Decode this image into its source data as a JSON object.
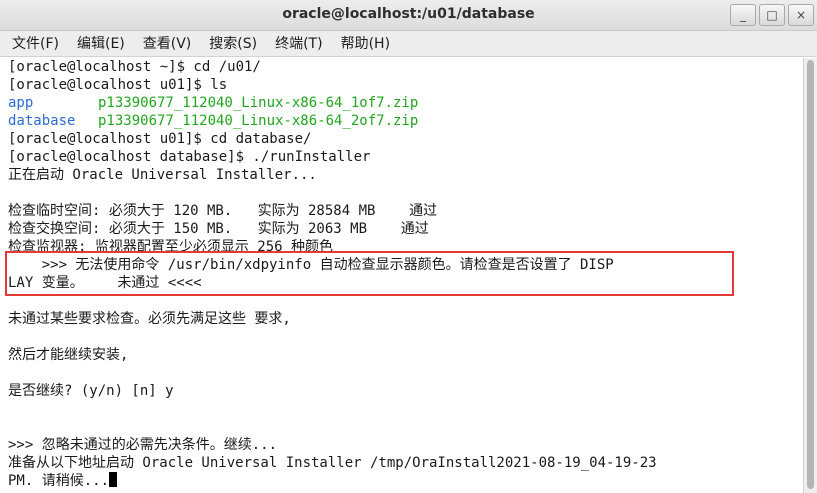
{
  "window": {
    "title": "oracle@localhost:/u01/database",
    "buttons": {
      "minimize": "_",
      "maximize": "□",
      "close": "×"
    }
  },
  "menu": [
    "文件(F)",
    "编辑(E)",
    "查看(V)",
    "搜索(S)",
    "终端(T)",
    "帮助(H)"
  ],
  "terminal": {
    "lines": [
      "[oracle@localhost ~]$ cd /u01/",
      "[oracle@localhost u01]$ ls",
      "",
      "",
      "[oracle@localhost u01]$ cd database/",
      "[oracle@localhost database]$ ./runInstaller",
      "正在启动 Oracle Universal Installer...",
      "",
      "检查临时空间: 必须大于 120 MB.   实际为 28584 MB    通过",
      "检查交换空间: 必须大于 150 MB.   实际为 2063 MB    通过",
      "检查监视器: 监视器配置至少必须显示 256 种颜色",
      "    >>> 无法使用命令 /usr/bin/xdpyinfo 自动检查显示器颜色。请检查是否设置了 DISP",
      "LAY 变量。    未通过 <<<<",
      "",
      "未通过某些要求检查。必须先满足这些 要求,",
      "",
      "然后才能继续安装,",
      "",
      "是否继续? (y/n) [n] y",
      "",
      "",
      ">>> 忽略未通过的必需先决条件。继续...",
      "准备从以下地址启动 Oracle Universal Installer /tmp/OraInstall2021-08-19_04-19-23",
      "PM. 请稍候..."
    ],
    "ls_row1": {
      "dir": "app",
      "file": "p13390677_112040_Linux-x86-64_1of7.zip"
    },
    "ls_row2": {
      "dir": "database",
      "file": "p13390677_112040_Linux-x86-64_2of7.zip"
    }
  },
  "colors": {
    "dir": "#2c6bd6",
    "file": "#22a51f",
    "highlight": "#e53935"
  }
}
